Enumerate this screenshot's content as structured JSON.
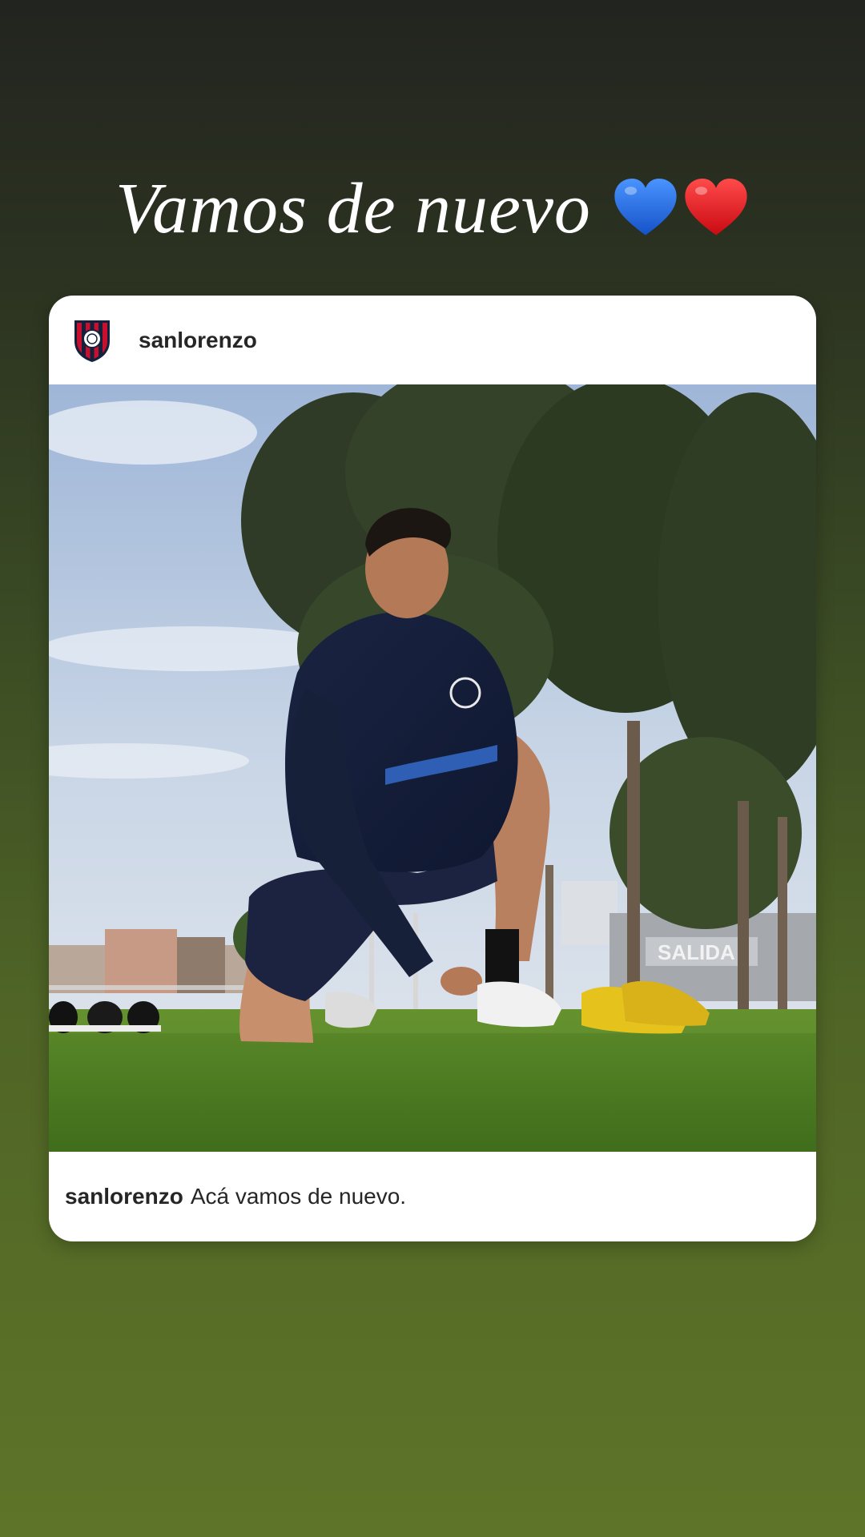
{
  "story": {
    "caption_text": "Vamos de nuevo",
    "caption_emojis": [
      "blue-heart",
      "red-heart"
    ]
  },
  "post": {
    "username": "sanlorenzo",
    "avatar_icon": "club-crest-icon",
    "photo_description_icon": "player-photo",
    "photo_signage": "SALIDA",
    "caption_author": "sanlorenzo",
    "caption_text": "Acá vamos de nuevo."
  },
  "colors": {
    "blue_heart": "#1e6fe0",
    "red_heart": "#e3141d",
    "crest_red": "#c8102e",
    "crest_navy": "#14213d"
  }
}
